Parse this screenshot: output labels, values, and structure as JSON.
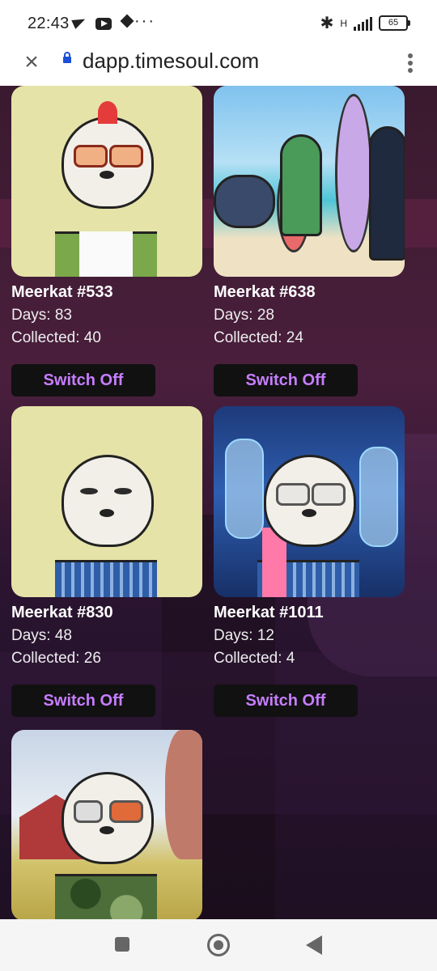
{
  "status_bar": {
    "time": "22:43",
    "icons": [
      "telegram-icon",
      "youtube-icon",
      "diamond-icon"
    ],
    "more": "···",
    "network": "H",
    "battery": "65"
  },
  "browser": {
    "url": "dapp.timesoul.com",
    "close_icon": "close-icon",
    "menu_icon": "kebab-menu-icon"
  },
  "cards": [
    {
      "name": "Meerkat #533",
      "days": "Days: 83",
      "collected": "Collected: 40",
      "button": "Switch Off"
    },
    {
      "name": "Meerkat #638",
      "days": "Days: 28",
      "collected": "Collected: 24",
      "button": "Switch Off"
    },
    {
      "name": "Meerkat #830",
      "days": "Days: 48",
      "collected": "Collected: 26",
      "button": "Switch Off"
    },
    {
      "name": "Meerkat #1011",
      "days": "Days: 12",
      "collected": "Collected: 4",
      "button": "Switch Off"
    }
  ],
  "colors": {
    "button_text": "#c77dff",
    "button_bg": "#111111"
  },
  "nav": {
    "recent_icon": "square-icon",
    "home_icon": "home-circle-icon",
    "back_icon": "back-triangle-icon"
  }
}
